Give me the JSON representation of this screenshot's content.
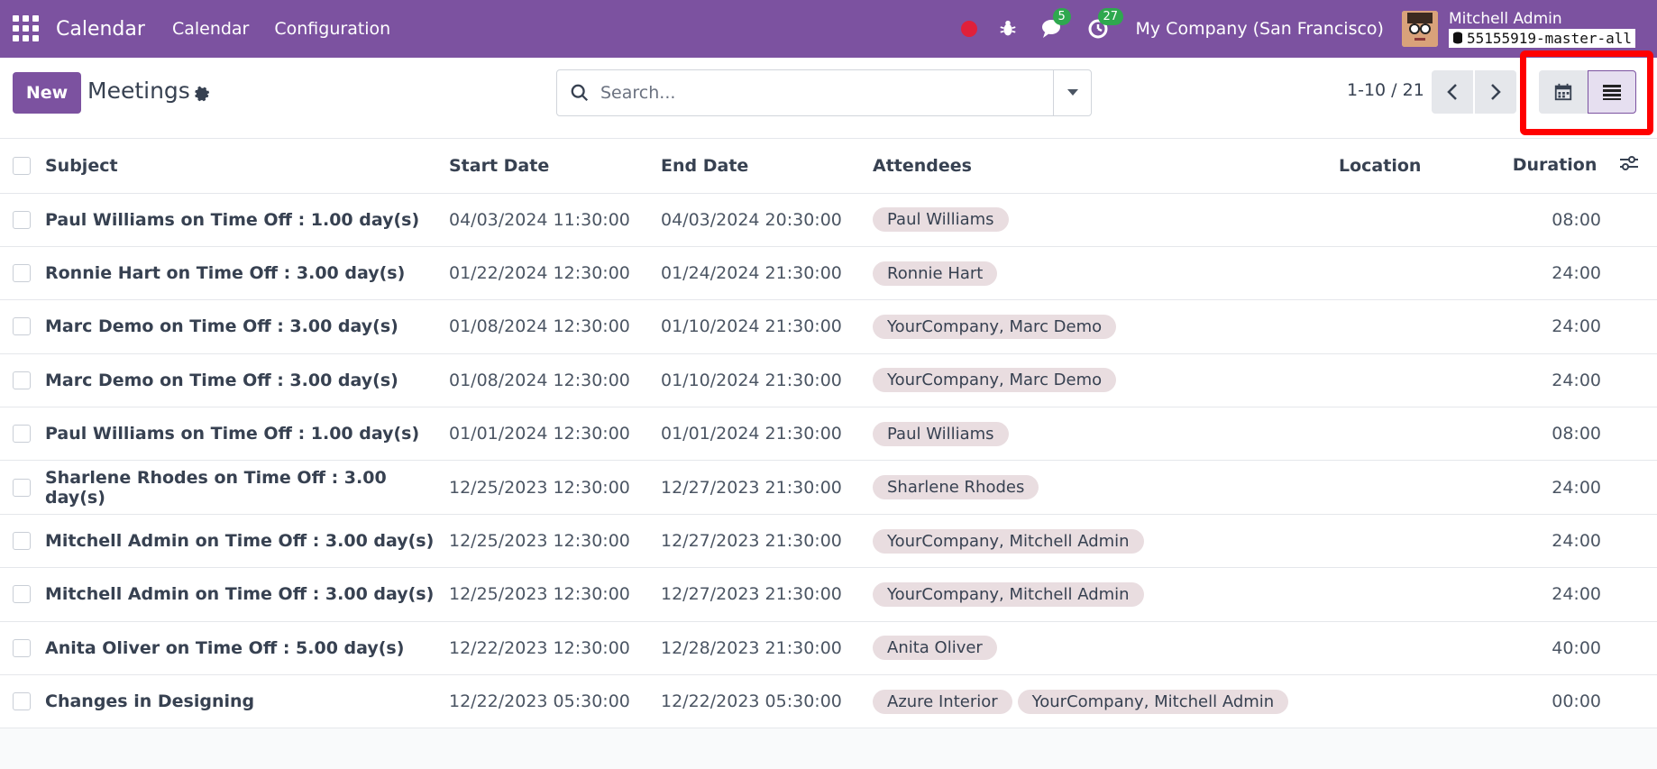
{
  "navbar": {
    "brand": "Calendar",
    "menu": [
      "Calendar",
      "Configuration"
    ],
    "chat_badge": "5",
    "activity_badge": "27",
    "company": "My Company (San Francisco)",
    "user_name": "Mitchell Admin",
    "db_name": "55155919-master-all"
  },
  "control": {
    "new_label": "New",
    "title": "Meetings",
    "search_placeholder": "Search...",
    "pager": "1-10 / 21"
  },
  "table": {
    "headers": {
      "subject": "Subject",
      "start": "Start Date",
      "end": "End Date",
      "attendees": "Attendees",
      "location": "Location",
      "duration": "Duration"
    },
    "rows": [
      {
        "subject": "Paul Williams on Time Off : 1.00 day(s)",
        "start": "04/03/2024 11:30:00",
        "end": "04/03/2024 20:30:00",
        "attendees": [
          "Paul Williams"
        ],
        "location": "",
        "duration": "08:00"
      },
      {
        "subject": "Ronnie Hart on Time Off : 3.00 day(s)",
        "start": "01/22/2024 12:30:00",
        "end": "01/24/2024 21:30:00",
        "attendees": [
          "Ronnie Hart"
        ],
        "location": "",
        "duration": "24:00"
      },
      {
        "subject": "Marc Demo on Time Off : 3.00 day(s)",
        "start": "01/08/2024 12:30:00",
        "end": "01/10/2024 21:30:00",
        "attendees": [
          "YourCompany, Marc Demo"
        ],
        "location": "",
        "duration": "24:00"
      },
      {
        "subject": "Marc Demo on Time Off : 3.00 day(s)",
        "start": "01/08/2024 12:30:00",
        "end": "01/10/2024 21:30:00",
        "attendees": [
          "YourCompany, Marc Demo"
        ],
        "location": "",
        "duration": "24:00"
      },
      {
        "subject": "Paul Williams on Time Off : 1.00 day(s)",
        "start": "01/01/2024 12:30:00",
        "end": "01/01/2024 21:30:00",
        "attendees": [
          "Paul Williams"
        ],
        "location": "",
        "duration": "08:00"
      },
      {
        "subject": "Sharlene Rhodes on Time Off : 3.00 day(s)",
        "start": "12/25/2023 12:30:00",
        "end": "12/27/2023 21:30:00",
        "attendees": [
          "Sharlene Rhodes"
        ],
        "location": "",
        "duration": "24:00"
      },
      {
        "subject": "Mitchell Admin on Time Off : 3.00 day(s)",
        "start": "12/25/2023 12:30:00",
        "end": "12/27/2023 21:30:00",
        "attendees": [
          "YourCompany, Mitchell Admin"
        ],
        "location": "",
        "duration": "24:00"
      },
      {
        "subject": "Mitchell Admin on Time Off : 3.00 day(s)",
        "start": "12/25/2023 12:30:00",
        "end": "12/27/2023 21:30:00",
        "attendees": [
          "YourCompany, Mitchell Admin"
        ],
        "location": "",
        "duration": "24:00"
      },
      {
        "subject": "Anita Oliver on Time Off : 5.00 day(s)",
        "start": "12/22/2023 12:30:00",
        "end": "12/28/2023 21:30:00",
        "attendees": [
          "Anita Oliver"
        ],
        "location": "",
        "duration": "40:00"
      },
      {
        "subject": "Changes in Designing",
        "start": "12/22/2023 05:30:00",
        "end": "12/22/2023 05:30:00",
        "attendees": [
          "Azure Interior",
          "YourCompany, Mitchell Admin"
        ],
        "location": "",
        "duration": "00:00"
      }
    ]
  }
}
